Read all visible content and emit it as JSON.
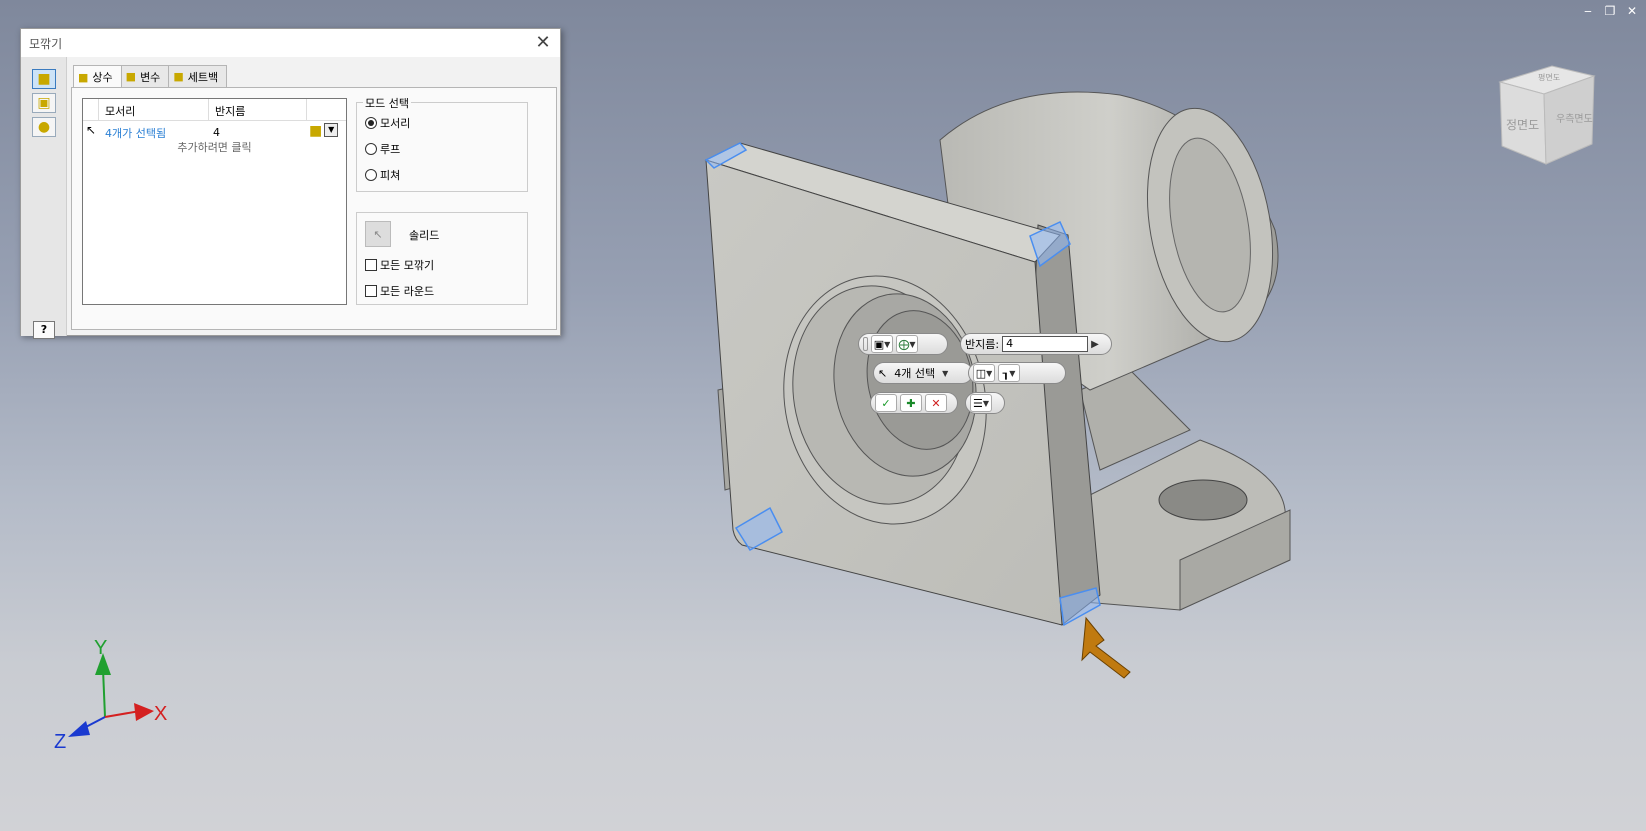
{
  "dialog": {
    "title": "모깎기",
    "tabs": [
      {
        "label": "상수",
        "active": true
      },
      {
        "label": "변수",
        "active": false
      },
      {
        "label": "세트백",
        "active": false
      }
    ],
    "table": {
      "col_edge": "모서리",
      "col_radius": "반지름",
      "row_edge": "4개가 선택됨",
      "row_radius": "4",
      "add_hint": "추가하려면 클릭"
    },
    "mode_group": {
      "title": "모드 선택",
      "options": [
        {
          "label": "모서리",
          "selected": true
        },
        {
          "label": "루프",
          "selected": false
        },
        {
          "label": "피쳐",
          "selected": false
        }
      ]
    },
    "solid_group": {
      "solid_label": "솔리드",
      "all_fillets": "모든 모깎기",
      "all_rounds": "모든 라운드"
    },
    "help": "?"
  },
  "minitoolbar": {
    "radius_label": "반지름:",
    "radius_value": "4",
    "selection_label": "4개 선택"
  },
  "viewcube": {
    "front": "정면도",
    "right": "우측면도",
    "top": "평면도"
  },
  "triad": {
    "x": "X",
    "y": "Y",
    "z": "Z"
  },
  "colors": {
    "highlight_blue": "#4a8ef0",
    "arrow_orange": "#c07a10",
    "x_axis": "#d42020",
    "y_axis": "#20a030",
    "z_axis": "#1a3ad0"
  }
}
